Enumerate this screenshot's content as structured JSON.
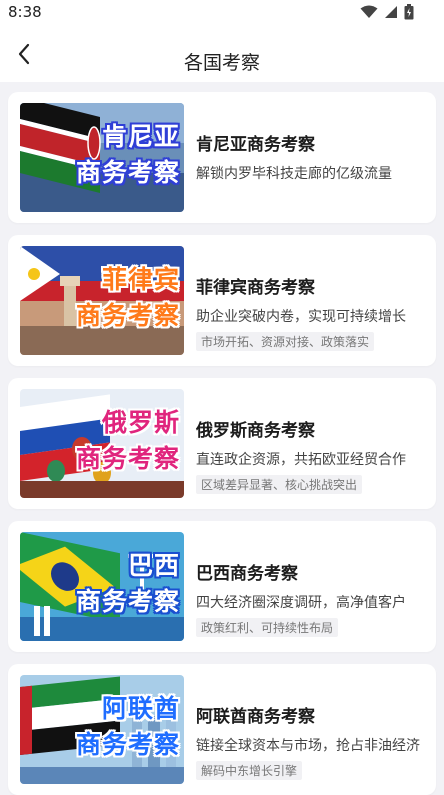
{
  "status_bar": {
    "time": "8:38"
  },
  "header": {
    "title": "各国考察"
  },
  "cards": [
    {
      "thumb": {
        "line1": "肯尼亚",
        "line2": "商务考察",
        "line1_color": "#ffffff",
        "line2_color": "#ffffff",
        "stroke": "#2f3fd6"
      },
      "name": "肯尼亚商务考察",
      "desc": "解锁内罗毕科技走廊的亿级流量",
      "tag": ""
    },
    {
      "thumb": {
        "line1": "菲律宾",
        "line2": "商务考察",
        "line1_color": "#ff7a1a",
        "line2_color": "#ff7a1a",
        "stroke": "#ffffff"
      },
      "name": "菲律宾商务考察",
      "desc": "助企业突破内卷，实现可持续增长",
      "tag": "市场开拓、资源对接、政策落实"
    },
    {
      "thumb": {
        "line1": "俄罗斯",
        "line2": "商务考察",
        "line1_color": "#e0257d",
        "line2_color": "#e0257d",
        "stroke": "#ffffff"
      },
      "name": "俄罗斯商务考察",
      "desc": "直连政企资源，共拓欧亚经贸合作",
      "tag": "区域差异显著、核心挑战突出"
    },
    {
      "thumb": {
        "line1": "巴西",
        "line2": "商务考察",
        "line1_color": "#ffffff",
        "line2_color": "#ffffff",
        "stroke": "#1a4fd0"
      },
      "name": "巴西商务考察",
      "desc": "四大经济圈深度调研，高净值客户",
      "tag": "政策红利、可持续性布局"
    },
    {
      "thumb": {
        "line1": "阿联酋",
        "line2": "商务考察",
        "line1_color": "#1f6dff",
        "line2_color": "#1f6dff",
        "stroke": "#ffffff"
      },
      "name": "阿联酋商务考察",
      "desc": "链接全球资本与市场，抢占非油经济",
      "tag": "解码中东增长引擎"
    }
  ]
}
